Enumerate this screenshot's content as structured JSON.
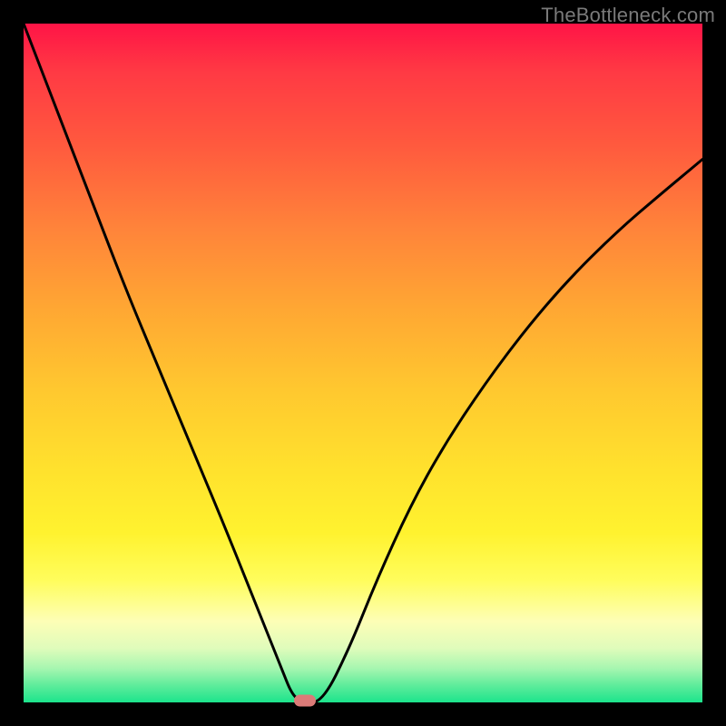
{
  "watermark": "TheBottleneck.com",
  "chart_data": {
    "type": "line",
    "title": "",
    "xlabel": "",
    "ylabel": "",
    "xlim": [
      0,
      1
    ],
    "ylim": [
      0,
      1
    ],
    "background_gradient": {
      "top": "#ff1446",
      "bottom": "#1ce48c",
      "meaning": "red-high to green-low"
    },
    "series": [
      {
        "name": "bottleneck-curve",
        "x": [
          0.0,
          0.05,
          0.1,
          0.15,
          0.2,
          0.25,
          0.3,
          0.35,
          0.38,
          0.395,
          0.41,
          0.44,
          0.48,
          0.52,
          0.57,
          0.62,
          0.68,
          0.74,
          0.8,
          0.87,
          0.94,
          1.0
        ],
        "y": [
          1.0,
          0.87,
          0.74,
          0.61,
          0.49,
          0.37,
          0.25,
          0.125,
          0.05,
          0.012,
          0.0,
          0.0,
          0.08,
          0.18,
          0.29,
          0.38,
          0.47,
          0.55,
          0.62,
          0.69,
          0.75,
          0.8
        ]
      }
    ],
    "annotations": [
      {
        "name": "optimal-marker",
        "x": 0.415,
        "y": 0.003,
        "color": "#db7b78",
        "shape": "pill"
      }
    ]
  }
}
